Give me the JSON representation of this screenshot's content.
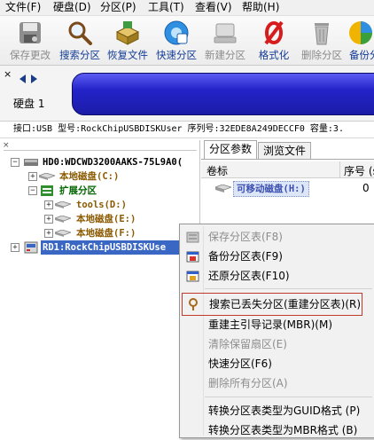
{
  "menubar": {
    "items": [
      {
        "label": "文件(F)"
      },
      {
        "label": "硬盘(D)"
      },
      {
        "label": "分区(P)"
      },
      {
        "label": "工具(T)"
      },
      {
        "label": "查看(V)"
      },
      {
        "label": "帮助(H)"
      }
    ]
  },
  "toolbar": {
    "buttons": [
      {
        "label": "保存更改",
        "icon": "save-disk-icon",
        "enabled": false
      },
      {
        "label": "搜索分区",
        "icon": "magnifier-icon",
        "enabled": true
      },
      {
        "label": "恢复文件",
        "icon": "recover-files-icon",
        "enabled": true
      },
      {
        "label": "快速分区",
        "icon": "quick-partition-icon",
        "enabled": true
      },
      {
        "label": "新建分区",
        "icon": "new-partition-icon",
        "enabled": false
      },
      {
        "label": "格式化",
        "icon": "format-icon",
        "enabled": true
      },
      {
        "label": "删除分区",
        "icon": "trash-icon",
        "enabled": false
      },
      {
        "label": "备份分",
        "icon": "backup-icon",
        "enabled": true
      }
    ]
  },
  "disk_bar": {
    "disk_label": "硬盘 1",
    "close_glyph": "×"
  },
  "info_bar": {
    "text": "接口:USB  型号:RockChipUSBDISKUser  序列号:32EDE8A249DECCF0  容量:3."
  },
  "tree": {
    "items": [
      {
        "label": "HD0:WDCWD3200AAKS-75L9A0(",
        "color": "#000000"
      },
      {
        "label": "本地磁盘(C:)",
        "color": "#8b5a00"
      },
      {
        "label": "扩展分区",
        "color": "#006600"
      },
      {
        "label": "tools(D:)",
        "color": "#8b5a00"
      },
      {
        "label": "本地磁盘(E:)",
        "color": "#8b5a00"
      },
      {
        "label": "本地磁盘(F:)",
        "color": "#8b5a00"
      },
      {
        "label": "RD1:RockChipUSBDISKUse",
        "color": "#ffffff"
      }
    ]
  },
  "right_panel": {
    "tabs": [
      {
        "label": "分区参数"
      },
      {
        "label": "浏览文件"
      }
    ],
    "columns": [
      {
        "label": "卷标"
      },
      {
        "label": "序号 (s"
      }
    ],
    "rows": [
      {
        "label": "可移动磁盘(H:)",
        "index": "0"
      }
    ]
  },
  "context_menu": {
    "items": [
      {
        "label": "保存分区表(F8)",
        "enabled": false,
        "icon": "save-table-icon"
      },
      {
        "label": "备份分区表(F9)",
        "enabled": true,
        "icon": "backup-table-icon"
      },
      {
        "label": "还原分区表(F10)",
        "enabled": true,
        "icon": "restore-table-icon"
      },
      {
        "label": "搜索已丢失分区(重建分区表)(R)",
        "enabled": true,
        "icon": "search-lost-icon",
        "highlighted": true
      },
      {
        "label": "重建主引导记录(MBR)(M)",
        "enabled": true
      },
      {
        "label": "清除保留扇区(E)",
        "enabled": false
      },
      {
        "label": "快速分区(F6)",
        "enabled": true
      },
      {
        "label": "删除所有分区(A)",
        "enabled": false
      },
      {
        "label": "转换分区表类型为GUID格式 (P)",
        "enabled": true
      },
      {
        "label": "转换分区表类型为MBR格式 (B)",
        "enabled": true
      }
    ]
  },
  "colors": {
    "accent": "#143c96",
    "disk_bar": "#2323c9",
    "highlight_box": "#c0392b",
    "selection": "#3a66c4"
  }
}
